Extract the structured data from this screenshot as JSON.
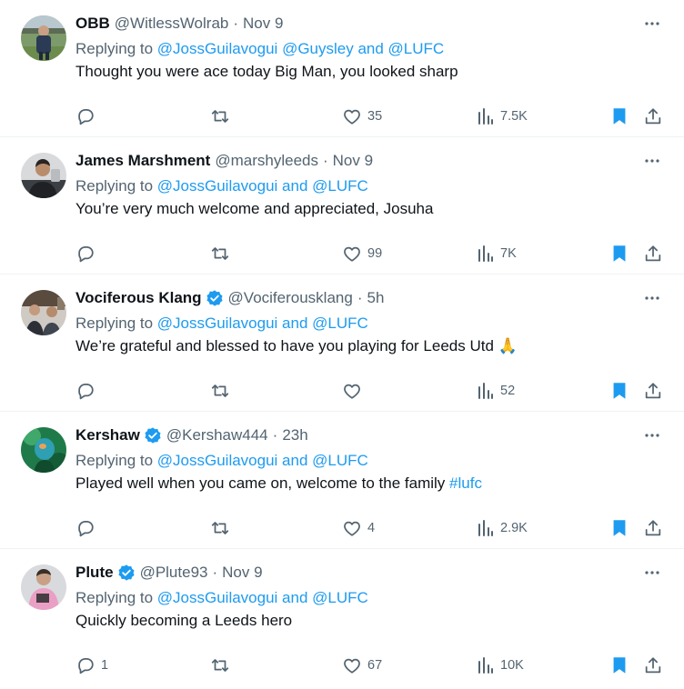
{
  "replies": [
    {
      "author_name": "OBB",
      "handle": "@WitlessWolrab",
      "separator": "·",
      "time": "Nov 9",
      "verified": false,
      "reply_prefix": "Replying to ",
      "reply_mentions": [
        {
          "text": "@JossGuilavogui"
        },
        {
          "text": " "
        },
        {
          "text": "@Guysley"
        },
        {
          "text": " and "
        },
        {
          "text": "@LUFC"
        }
      ],
      "text_parts": [
        {
          "text": "Thought you were ace today Big Man, you looked sharp"
        }
      ],
      "stats": {
        "replies": "",
        "retweets": "",
        "likes": "35",
        "views": "7.5K"
      },
      "bookmarked": true
    },
    {
      "author_name": "James Marshment",
      "handle": "@marshyleeds",
      "separator": "·",
      "time": "Nov 9",
      "verified": false,
      "reply_prefix": "Replying to ",
      "reply_mentions": [
        {
          "text": "@JossGuilavogui"
        },
        {
          "text": " and "
        },
        {
          "text": "@LUFC"
        }
      ],
      "text_parts": [
        {
          "text": "You’re very much welcome and appreciated, Josuha"
        }
      ],
      "stats": {
        "replies": "",
        "retweets": "",
        "likes": "99",
        "views": "7K"
      },
      "bookmarked": true
    },
    {
      "author_name": "Vociferous Klang",
      "handle": "@Vociferousklang",
      "separator": "·",
      "time": "5h",
      "verified": true,
      "reply_prefix": "Replying to ",
      "reply_mentions": [
        {
          "text": "@JossGuilavogui"
        },
        {
          "text": " and "
        },
        {
          "text": "@LUFC"
        }
      ],
      "text_parts": [
        {
          "text": "We’re grateful and blessed to have you playing for Leeds Utd 🙏"
        }
      ],
      "stats": {
        "replies": "",
        "retweets": "",
        "likes": "",
        "views": "52"
      },
      "bookmarked": true
    },
    {
      "author_name": "Kershaw",
      "handle": "@Kershaw444",
      "separator": "·",
      "time": "23h",
      "verified": true,
      "reply_prefix": "Replying to ",
      "reply_mentions": [
        {
          "text": "@JossGuilavogui"
        },
        {
          "text": " and "
        },
        {
          "text": "@LUFC"
        }
      ],
      "text_parts": [
        {
          "text": "Played well when you came on, welcome to the family "
        },
        {
          "text": "#lufc"
        }
      ],
      "stats": {
        "replies": "",
        "retweets": "",
        "likes": "4",
        "views": "2.9K"
      },
      "bookmarked": true
    },
    {
      "author_name": "Plute",
      "handle": "@Plute93",
      "separator": "·",
      "time": "Nov 9",
      "verified": true,
      "reply_prefix": "Replying to ",
      "reply_mentions": [
        {
          "text": "@JossGuilavogui"
        },
        {
          "text": " and "
        },
        {
          "text": "@LUFC"
        }
      ],
      "text_parts": [
        {
          "text": "Quickly becoming a Leeds hero"
        }
      ],
      "stats": {
        "replies": "1",
        "retweets": "",
        "likes": "67",
        "views": "10K"
      },
      "bookmarked": true
    }
  ],
  "icons": {
    "more": "more-dots-icon",
    "reply": "reply-bubble-icon",
    "retweet": "retweet-icon",
    "like": "heart-icon",
    "views": "views-bars-icon",
    "bookmark": "bookmark-icon",
    "share": "share-icon",
    "verified": "verified-badge-icon"
  },
  "colors": {
    "link": "#1d9bf0",
    "secondary_text": "#536471",
    "primary_text": "#0f1419",
    "bookmark_active": "#1d9bf0",
    "verified_badge": "#1d9bf0",
    "divider": "#eff3f4"
  }
}
